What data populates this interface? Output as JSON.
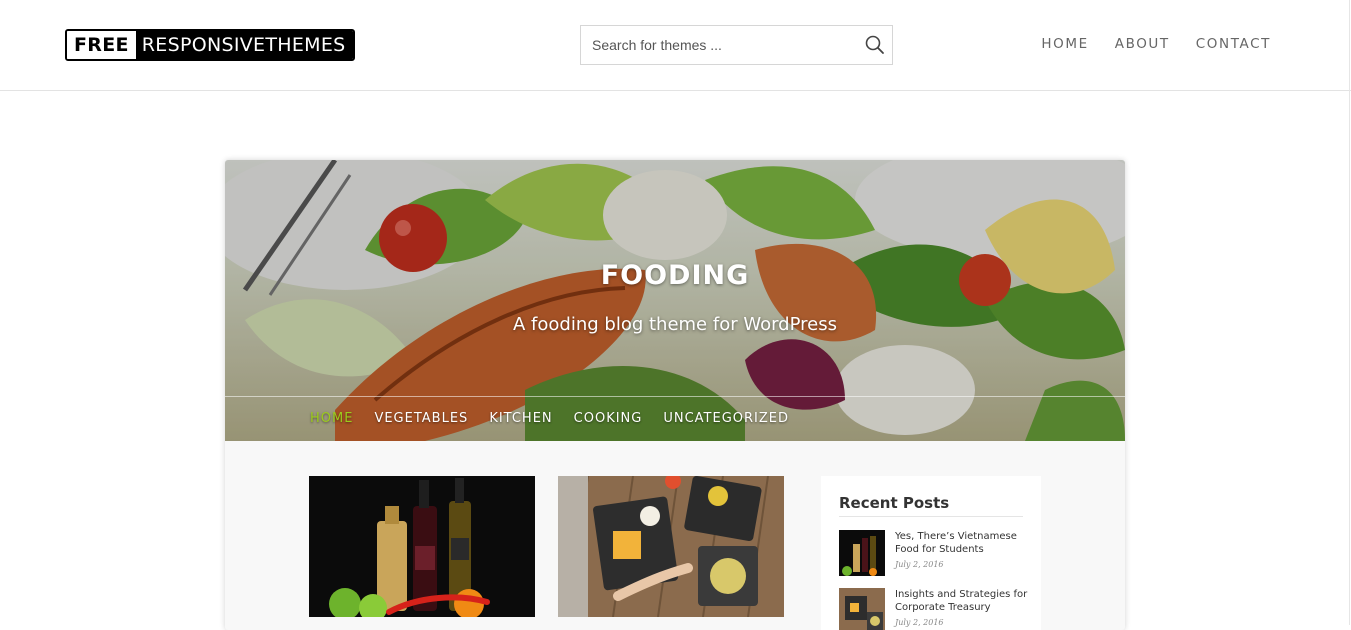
{
  "header": {
    "logo_free": "FREE",
    "logo_rest": "RESPONSIVETHEMES",
    "search_placeholder": "Search for themes ...",
    "nav": [
      "HOME",
      "ABOUT",
      "CONTACT"
    ]
  },
  "preview": {
    "title": "FOODING",
    "tagline": "A fooding blog theme for WordPress",
    "menu": [
      "HOME",
      "VEGETABLES",
      "KITCHEN",
      "COOKING",
      "UNCATEGORIZED"
    ],
    "active_menu": "HOME",
    "accent_color": "#9ccc1c",
    "widget": {
      "title": "Recent Posts",
      "posts": [
        {
          "title": "Yes, There’s Vietnamese Food for Students",
          "date": "July 2, 2016"
        },
        {
          "title": "Insights and Strategies for Corporate Treasury",
          "date": "July 2, 2016"
        }
      ]
    }
  },
  "icons": {
    "search": "search-icon"
  }
}
